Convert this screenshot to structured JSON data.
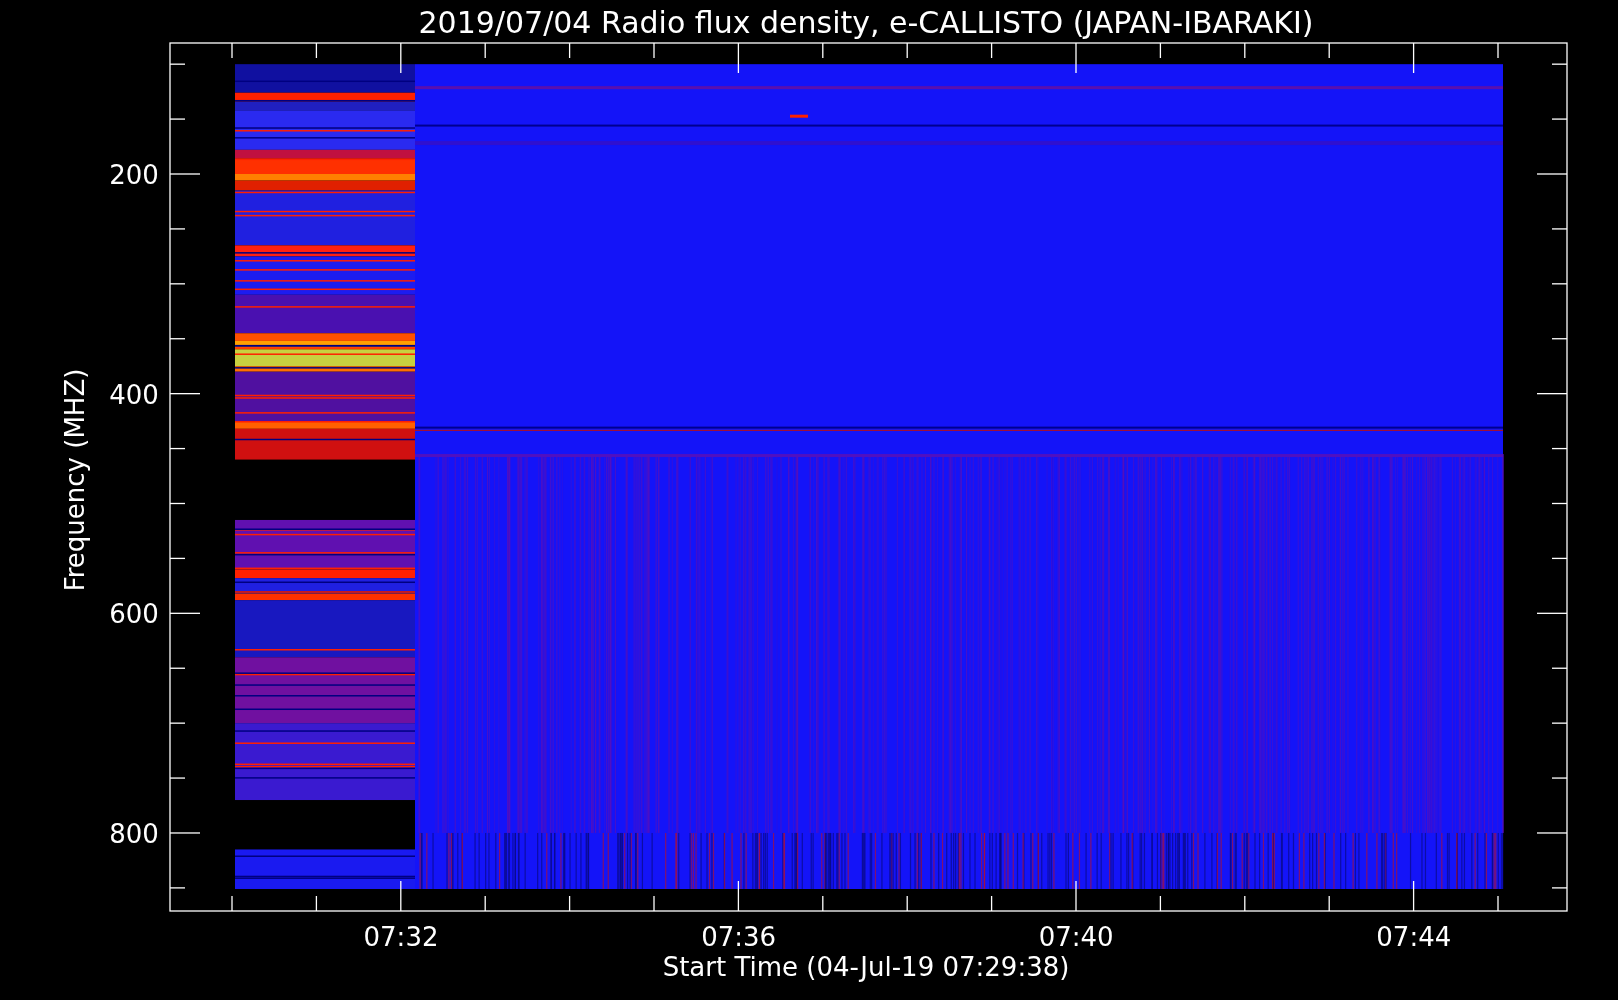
{
  "title": "2019/07/04  Radio flux density, e-CALLISTO (JAPAN-IBARAKI)",
  "spectrogram": {
    "ylabel": "Frequency (MHZ)",
    "xlabel": "Start Time (04-Jul-19 07:29:38)",
    "y_tick_labels": [
      "200",
      "400",
      "600",
      "800"
    ],
    "x_tick_labels": [
      "07:32",
      "07:36",
      "07:40",
      "07:44"
    ]
  }
}
